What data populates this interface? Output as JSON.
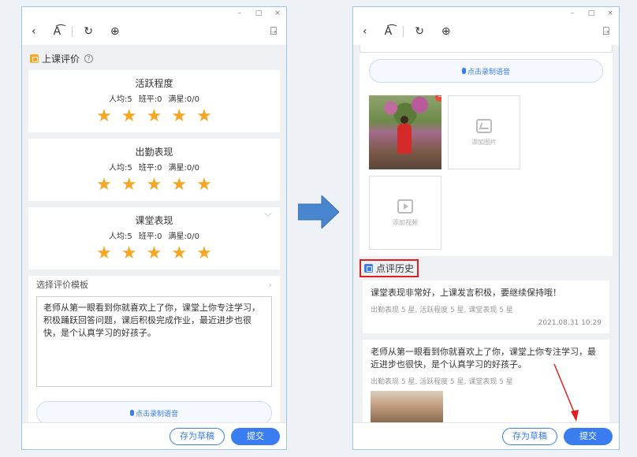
{
  "left": {
    "window_controls": [
      "–",
      "□",
      "×"
    ],
    "toolbar": {
      "back": "‹",
      "font": "A͡",
      "refresh": "↻",
      "globe": "⊕",
      "exit": "⍈"
    },
    "section_title": "上课评价",
    "help": "?",
    "cards": [
      {
        "title": "活跃程度",
        "avg": "人均:5",
        "class_avg": "班平:0",
        "full": "满星:0/0",
        "stars": 5
      },
      {
        "title": "出勤表现",
        "avg": "人均:5",
        "class_avg": "班平:0",
        "full": "满星:0/0",
        "stars": 5
      },
      {
        "title": "课堂表现",
        "avg": "人均:5",
        "class_avg": "班平:0",
        "full": "满星:0/0",
        "stars": 5
      }
    ],
    "template_label": "选择评价模板",
    "comment_text": "老师从第一眼看到你就喜欢上了你，课堂上你专注学习，积极踊跃回答问题，课后积极完成作业，最近进步也很快，是个认真学习的好孩子。",
    "voice_label": "点击录制语音",
    "draft_label": "存为草稿",
    "submit_label": "提交"
  },
  "right": {
    "window_controls": [
      "–",
      "□",
      "×"
    ],
    "toolbar": {
      "back": "‹",
      "font": "A͡",
      "refresh": "↻",
      "globe": "⊕",
      "exit": "⍈"
    },
    "voice_label": "点击录制语音",
    "add_image_label": "添加图片",
    "add_video_label": "添加视频",
    "history_title": "点评历史",
    "history": [
      {
        "text": "课堂表现非常好，上课发言积极，要继续保持哦！",
        "meta": "出勤表现 5 星, 活跃程度 5 星, 课堂表现 5 星",
        "date": "2021.08.31 10:29"
      },
      {
        "text": "老师从第一眼看到你就喜欢上了你，课堂上你专注学习，最近进步也很快，是个认真学习的好孩子。",
        "meta": "出勤表现 5 星, 活跃程度 5 星, 课堂表现 5 星",
        "date": ""
      }
    ],
    "draft_label": "存为草稿",
    "submit_label": "提交"
  },
  "colors": {
    "accent": "#3a7df0",
    "star": "#f5a623",
    "highlight": "#e02020",
    "arrow": "#4a86d0"
  }
}
